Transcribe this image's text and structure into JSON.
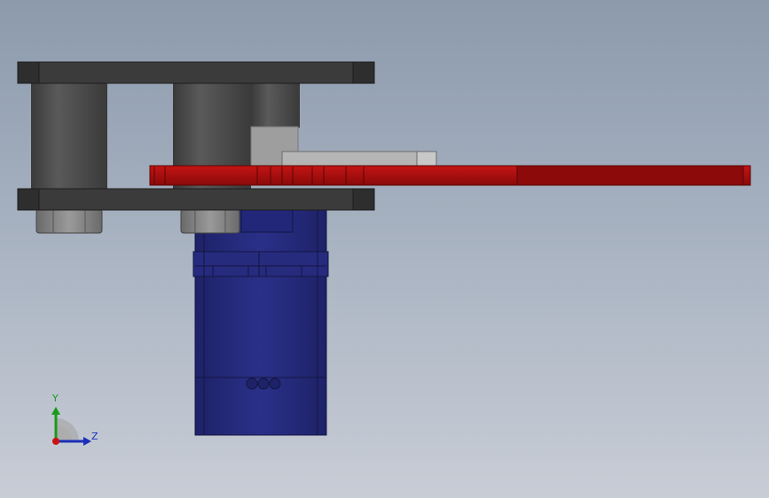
{
  "viewport": {
    "background_top": "#8c9aac",
    "background_bottom": "#c8cdd6"
  },
  "triad": {
    "y_label": "Y",
    "z_label": "Z",
    "y_color": "#1a9a1a",
    "z_color": "#1b2fb8",
    "x_color": "#cc1111"
  },
  "colors": {
    "plate": "#3b3b3b",
    "standoff": "#4a4a4a",
    "servo": "#252a7a",
    "arm": "#a80f0f",
    "nut": "#8a8a8a",
    "horn": "#b5b5b5"
  }
}
